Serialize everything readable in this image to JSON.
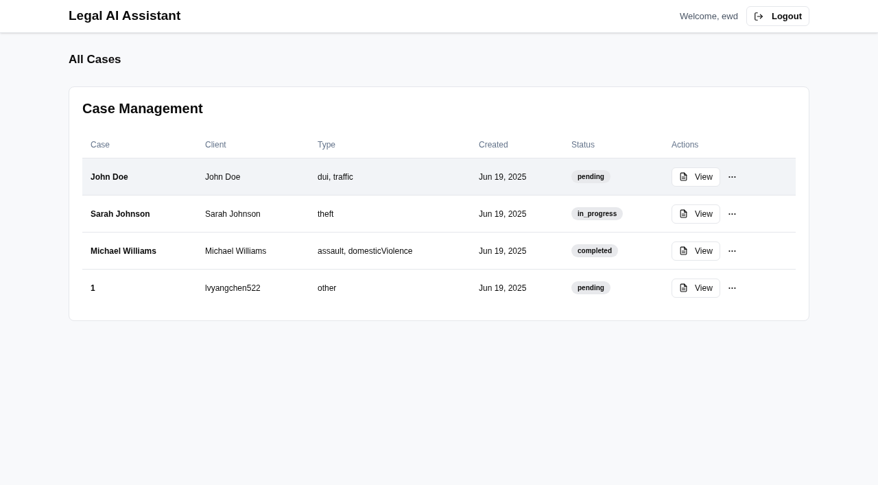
{
  "header": {
    "title": "Legal AI Assistant",
    "welcome": "Welcome, ewd",
    "logout": "Logout"
  },
  "page_title": "All Cases",
  "card": {
    "title": "Case Management",
    "columns": [
      "Case",
      "Client",
      "Type",
      "Created",
      "Status",
      "Actions"
    ],
    "rows": [
      {
        "case": "John Doe",
        "client": "John Doe",
        "type": "dui, traffic",
        "created": "Jun 19, 2025",
        "status": "pending",
        "action": "View",
        "more": "···",
        "selected": true
      },
      {
        "case": "Sarah Johnson",
        "client": "Sarah Johnson",
        "type": "theft",
        "created": "Jun 19, 2025",
        "status": "in_progress",
        "action": "View",
        "more": "···",
        "selected": false
      },
      {
        "case": "Michael Williams",
        "client": "Michael Williams",
        "type": "assault, domesticViolence",
        "created": "Jun 19, 2025",
        "status": "completed",
        "action": "View",
        "more": "···",
        "selected": false
      },
      {
        "case": "1",
        "client": "lvyangchen522",
        "type": "other",
        "created": "Jun 19, 2025",
        "status": "pending",
        "action": "View",
        "more": "···",
        "selected": false
      }
    ]
  }
}
